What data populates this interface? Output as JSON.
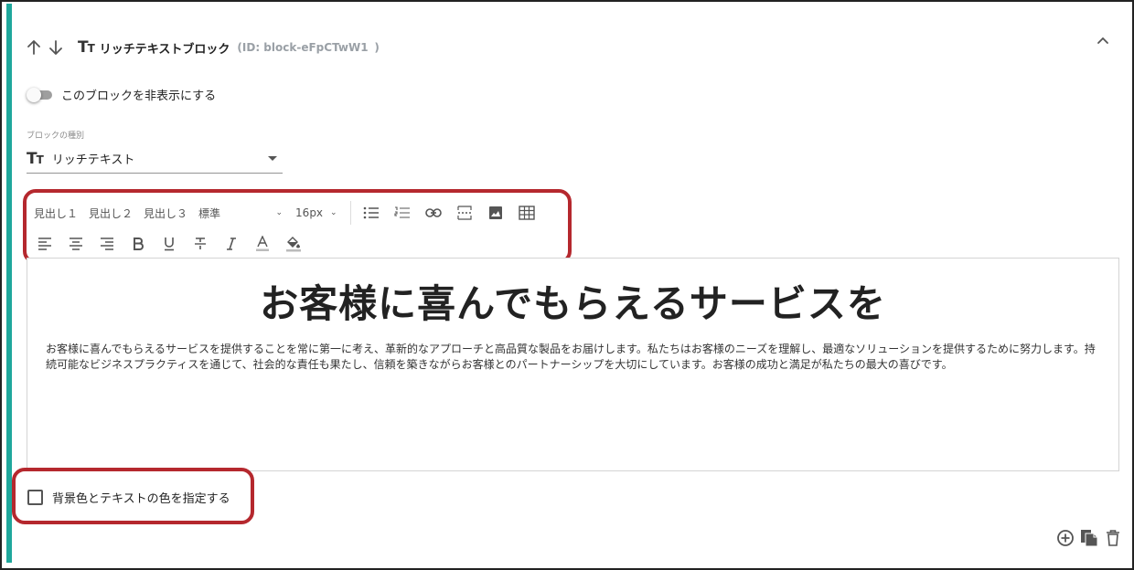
{
  "block": {
    "title": "リッチテキストブロック",
    "id_label": "(ID: block-eFpCTwW1",
    "id_close": ")",
    "icon": "text-format-icon",
    "accent_color": "#1fa79c"
  },
  "visibility": {
    "toggle_label": "このブロックを非表示にする",
    "enabled": false
  },
  "block_type": {
    "caption": "ブロックの種別",
    "value": "リッチテキスト"
  },
  "toolbar": {
    "headings": [
      "見出し１",
      "見出し２",
      "見出し３"
    ],
    "paragraph_style": "標準",
    "font_size": "16px",
    "icons_row1": [
      "bulleted-list-icon",
      "numbered-list-icon",
      "link-icon",
      "page-break-icon",
      "image-icon",
      "table-icon"
    ],
    "icons_row2": [
      "align-left-icon",
      "align-center-icon",
      "align-right-icon",
      "bold-icon",
      "underline-icon",
      "strikethrough-icon",
      "italic-icon",
      "text-color-icon",
      "fill-color-icon"
    ]
  },
  "editor": {
    "heading": "お客様に喜んでもらえるサービスを",
    "body": "お客様に喜んでもらえるサービスを提供することを常に第一に考え、革新的なアプローチと高品質な製品をお届けします。私たちはお客様のニーズを理解し、最適なソリューションを提供するために努力します。持続可能なビジネスプラクティスを通じて、社会的な責任も果たし、信頼を築きながらお客様とのパートナーシップを大切にしています。お客様の成功と満足が私たちの最大の喜びです。"
  },
  "color_option": {
    "label": "背景色とテキストの色を指定する",
    "checked": false
  },
  "highlight_color": "#b5282e"
}
